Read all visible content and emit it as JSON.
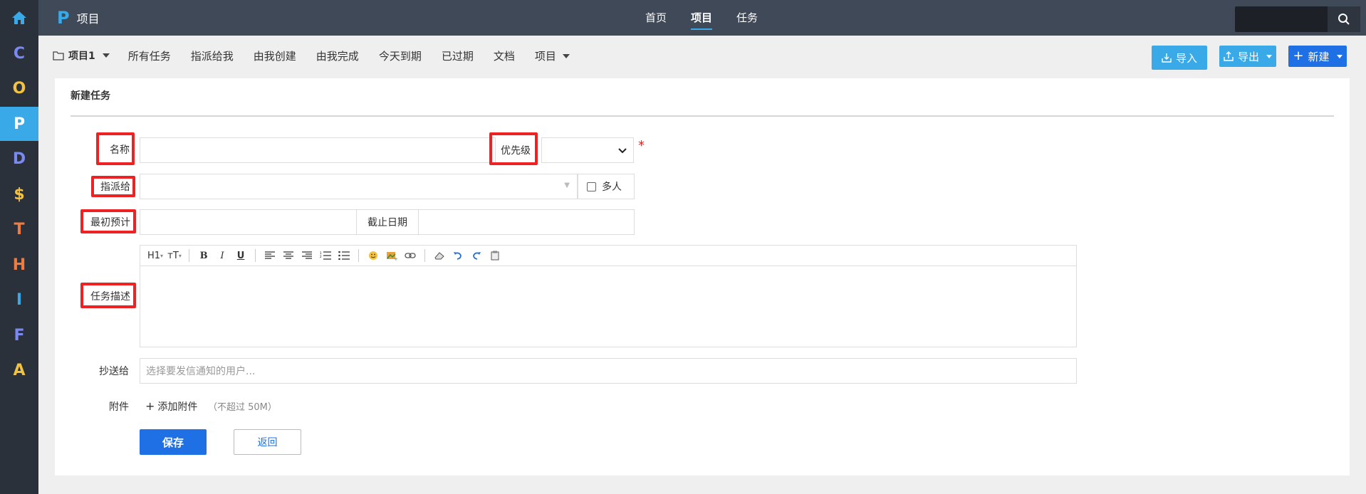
{
  "rail": {
    "items": [
      {
        "key": "home",
        "icon": "home-icon",
        "color": "#39a9e8"
      },
      {
        "key": "C",
        "label": "C",
        "color": "#7b8af0"
      },
      {
        "key": "O",
        "label": "O",
        "color": "#f3c33f"
      },
      {
        "key": "P",
        "label": "P",
        "color": "#ffffff",
        "active": true
      },
      {
        "key": "D",
        "label": "D",
        "color": "#7b8af0"
      },
      {
        "key": "$",
        "label": "$",
        "color": "#f3c33f"
      },
      {
        "key": "T",
        "label": "T",
        "color": "#f07b3f"
      },
      {
        "key": "H",
        "label": "H",
        "color": "#f07b3f"
      },
      {
        "key": "I",
        "label": "I",
        "color": "#39a9e8"
      },
      {
        "key": "F",
        "label": "F",
        "color": "#7b8af0"
      },
      {
        "key": "A",
        "label": "A",
        "color": "#f3c33f"
      }
    ]
  },
  "header": {
    "logo": "P",
    "title": "项目",
    "nav": [
      "首页",
      "项目",
      "任务"
    ],
    "active_nav": "项目"
  },
  "subnav": {
    "project": "项目1",
    "items": [
      "所有任务",
      "指派给我",
      "由我创建",
      "由我完成",
      "今天到期",
      "已过期",
      "文档",
      "项目"
    ]
  },
  "actions": {
    "import": "导入",
    "export": "导出",
    "create": "新建"
  },
  "colors": {
    "accent": "#39a9e8",
    "primary": "#1f6fe5",
    "highlight": "#e22222",
    "topbar": "#3f4957",
    "rail": "#2b313b"
  },
  "form": {
    "title": "新建任务",
    "name_label": "名称",
    "priority_label": "优先级",
    "assign_label": "指派给",
    "multi_label": "多人",
    "estimate_label": "最初预计",
    "deadline_label": "截止日期",
    "desc_label": "任务描述",
    "cc_label": "抄送给",
    "cc_placeholder": "选择要发信通知的用户...",
    "attach_label": "附件",
    "attach_button": "添加附件",
    "attach_limit": "（不超过 50M）",
    "save": "保存",
    "back": "返回",
    "required_mark": "*"
  },
  "editor": {
    "toolbar": [
      {
        "name": "heading-icon",
        "glyph": "H1"
      },
      {
        "name": "font-size-icon",
        "glyph": "тT"
      },
      {
        "name": "bold-icon",
        "glyph": "B"
      },
      {
        "name": "italic-icon",
        "glyph": "I"
      },
      {
        "name": "underline-icon",
        "glyph": "U"
      },
      {
        "name": "align-left-icon",
        "glyph": "≡"
      },
      {
        "name": "align-center-icon",
        "glyph": "≡"
      },
      {
        "name": "align-right-icon",
        "glyph": "≡"
      },
      {
        "name": "ordered-list-icon",
        "glyph": "☰"
      },
      {
        "name": "unordered-list-icon",
        "glyph": "☰"
      },
      {
        "name": "emoji-icon",
        "glyph": "☺"
      },
      {
        "name": "image-icon",
        "glyph": "▣"
      },
      {
        "name": "link-icon",
        "glyph": "∞"
      },
      {
        "name": "eraser-icon",
        "glyph": "◇"
      },
      {
        "name": "undo-icon",
        "glyph": "↶"
      },
      {
        "name": "redo-icon",
        "glyph": "↷"
      },
      {
        "name": "paste-icon",
        "glyph": "▤"
      }
    ]
  }
}
